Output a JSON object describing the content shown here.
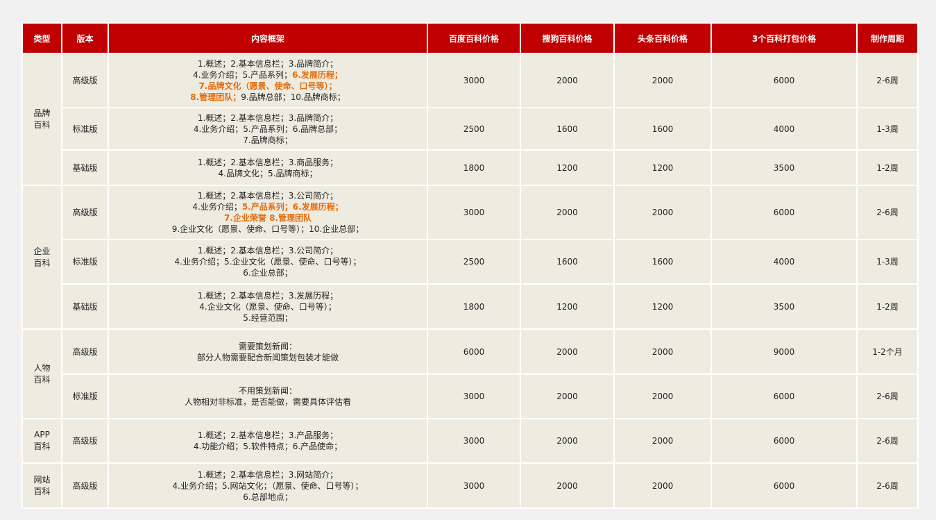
{
  "headers": [
    "类型",
    "版本",
    "内容框架",
    "百度百科价格",
    "搜狗百科价格",
    "头条百科价格",
    "3个百科打包价格",
    "制作周期"
  ],
  "rows": [
    {
      "type_lines": [
        "品牌",
        "百科"
      ],
      "edition": "高级版",
      "lines": [
        [
          {
            "t": "1.概述；2.基本信息栏；3.品牌简介；",
            "h": false
          }
        ],
        [
          {
            "t": "4.业务介绍；5.产品系列；",
            "h": false
          },
          {
            "t": "6.发展历程；",
            "h": true
          }
        ],
        [
          {
            "t": "7.品牌文化（愿景、使命、口号等）；",
            "h": true
          }
        ],
        [
          {
            "t": "8.管理团队；",
            "h": true
          },
          {
            "t": "9.品牌总部；10.品牌商标；",
            "h": false
          }
        ]
      ],
      "baidu": "3000",
      "sogou": "2000",
      "toutiao": "2000",
      "bundle": "6000",
      "period": "2-6周"
    },
    {
      "edition": "标准版",
      "lines": [
        [
          {
            "t": "1.概述；2.基本信息栏；3.品牌简介；",
            "h": false
          }
        ],
        [
          {
            "t": "4.业务介绍；5.产品系列；6.品牌总部；",
            "h": false
          }
        ],
        [
          {
            "t": "7.品牌商标；",
            "h": false
          }
        ]
      ],
      "baidu": "2500",
      "sogou": "1600",
      "toutiao": "1600",
      "bundle": "4000",
      "period": "1-3周"
    },
    {
      "edition": "基础版",
      "lines": [
        [
          {
            "t": "1.概述；2.基本信息栏；3.商品服务；",
            "h": false
          }
        ],
        [
          {
            "t": "4.品牌文化；5.品牌商标；",
            "h": false
          }
        ]
      ],
      "baidu": "1800",
      "sogou": "1200",
      "toutiao": "1200",
      "bundle": "3500",
      "period": "1-2周"
    },
    {
      "type_lines": [
        "企业",
        "百科"
      ],
      "edition": "高级版",
      "lines": [
        [
          {
            "t": "1.概述；2.基本信息栏；3.公司简介；",
            "h": false
          }
        ],
        [
          {
            "t": "4.业务介绍；",
            "h": false
          },
          {
            "t": "5.产品系列；6.发展历程；",
            "h": true
          }
        ],
        [
          {
            "t": "7.企业荣誉  8.管理团队",
            "h": true
          }
        ],
        [
          {
            "t": "9.企业文化（愿景、使命、口号等）；10.企业总部；",
            "h": false
          }
        ]
      ],
      "baidu": "3000",
      "sogou": "2000",
      "toutiao": "2000",
      "bundle": "6000",
      "period": "2-6周"
    },
    {
      "edition": "标准版",
      "lines": [
        [
          {
            "t": "1.概述；2.基本信息栏；3.公司简介；",
            "h": false
          }
        ],
        [
          {
            "t": "4.业务介绍；5.企业文化（愿景、使命、口号等）；",
            "h": false
          }
        ],
        [
          {
            "t": "6.企业总部；",
            "h": false
          }
        ]
      ],
      "baidu": "2500",
      "sogou": "1600",
      "toutiao": "1600",
      "bundle": "4000",
      "period": "1-3周"
    },
    {
      "edition": "基础版",
      "lines": [
        [
          {
            "t": "1.概述；2.基本信息栏；3.发展历程；",
            "h": false
          }
        ],
        [
          {
            "t": "4.企业文化（愿景、使命、口号等）；",
            "h": false
          }
        ],
        [
          {
            "t": "5.经营范围；",
            "h": false
          }
        ]
      ],
      "baidu": "1800",
      "sogou": "1200",
      "toutiao": "1200",
      "bundle": "3500",
      "period": "1-2周"
    },
    {
      "type_lines": [
        "人物",
        "百科"
      ],
      "edition": "高级版",
      "lines": [
        [
          {
            "t": "需要策划新闻：",
            "h": false
          }
        ],
        [
          {
            "t": "部分人物需要配合新闻策划包装才能做",
            "h": false
          }
        ]
      ],
      "baidu": "6000",
      "sogou": "2000",
      "toutiao": "2000",
      "bundle": "9000",
      "period": "1-2个月"
    },
    {
      "edition": "标准版",
      "lines": [
        [
          {
            "t": "不用策划新闻：",
            "h": false
          }
        ],
        [
          {
            "t": "人物相对非标准，是否能做，需要具体评估看",
            "h": false
          }
        ]
      ],
      "baidu": "3000",
      "sogou": "2000",
      "toutiao": "2000",
      "bundle": "6000",
      "period": "2-6周"
    },
    {
      "type_lines": [
        "APP",
        "百科"
      ],
      "edition": "高级版",
      "lines": [
        [
          {
            "t": "1.概述；2.基本信息栏；3.产品服务；",
            "h": false
          }
        ],
        [
          {
            "t": "4.功能介绍；5.软件特点；6.产品使命；",
            "h": false
          }
        ]
      ],
      "baidu": "3000",
      "sogou": "2000",
      "toutiao": "2000",
      "bundle": "6000",
      "period": "2-6周"
    },
    {
      "type_lines": [
        "网站",
        "百科"
      ],
      "edition": "高级版",
      "lines": [
        [
          {
            "t": "1.概述；2.基本信息栏；3.网站简介；",
            "h": false
          }
        ],
        [
          {
            "t": "4.业务介绍；5.网站文化；（愿景、使命、口号等）；",
            "h": false
          }
        ],
        [
          {
            "t": "6.总部地点；",
            "h": false
          }
        ]
      ],
      "baidu": "3000",
      "sogou": "2000",
      "toutiao": "2000",
      "bundle": "6000",
      "period": "2-6周"
    }
  ],
  "colors": {
    "header_bg": "#c00000",
    "cell_bg": "#eeebe1",
    "highlight": "#e46c0a"
  }
}
